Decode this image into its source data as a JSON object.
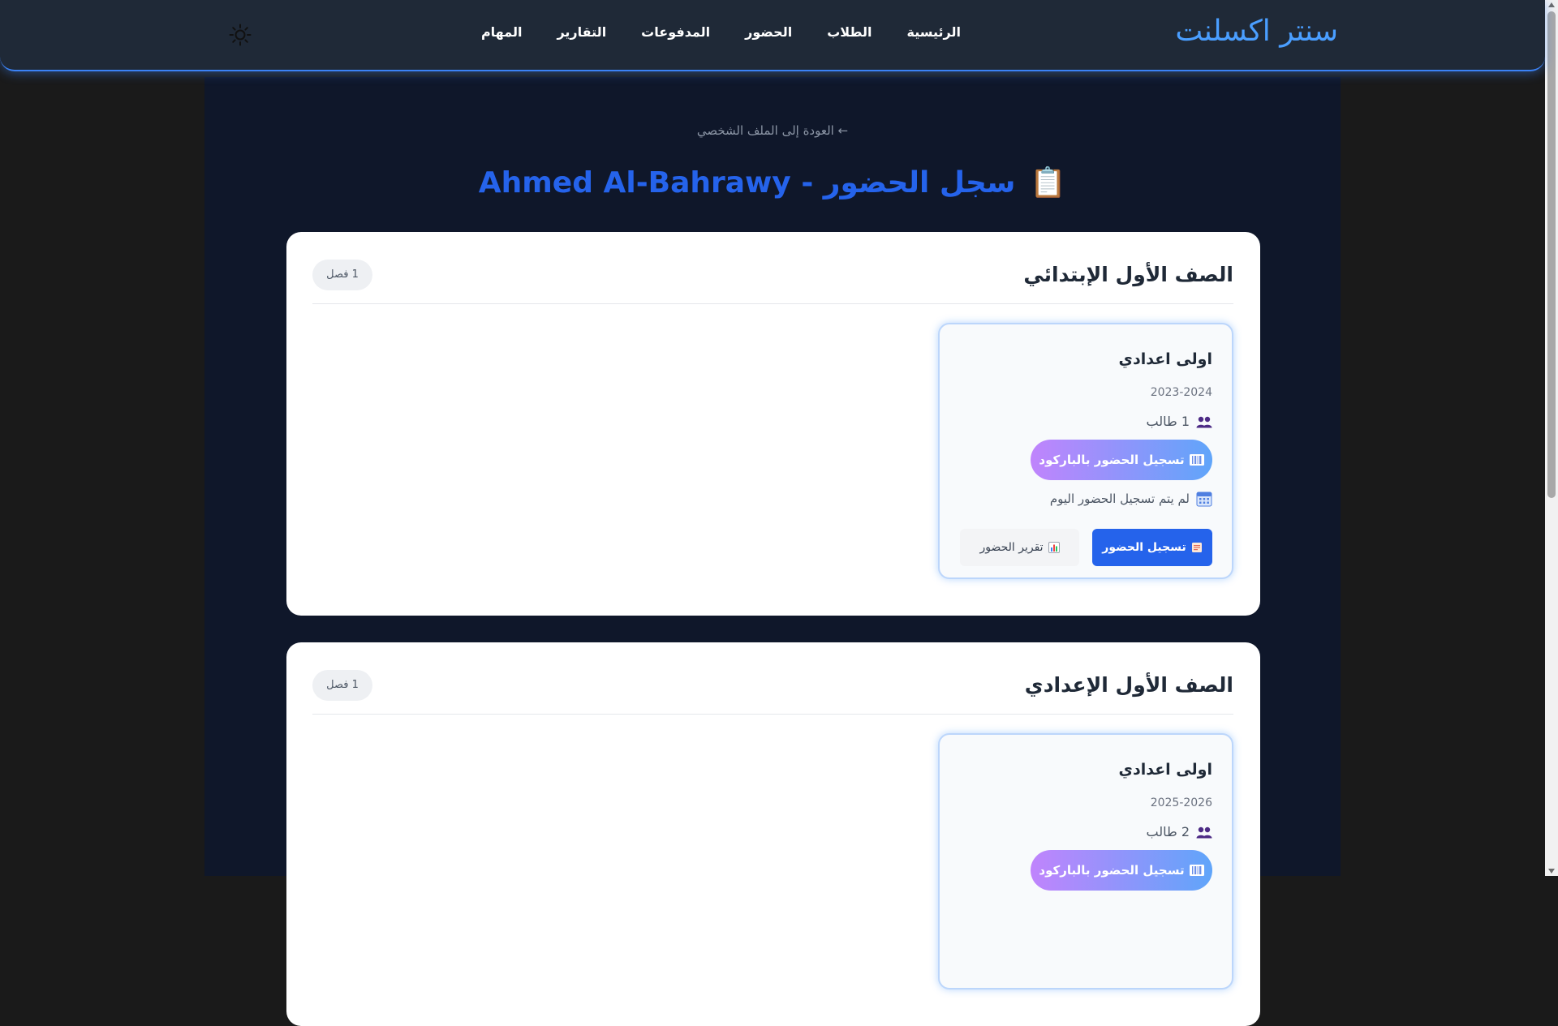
{
  "navbar": {
    "brand": "سنتر اكسلنت",
    "links": [
      "الرئيسية",
      "الطلاب",
      "الحضور",
      "المدفوعات",
      "التقارير",
      "المهام"
    ],
    "theme_icon": "sun-icon"
  },
  "page": {
    "back_link": "← العودة إلى الملف الشخصي",
    "title_icon": "📋",
    "title": "سجل الحضور - Ahmed Al-Bahrawy"
  },
  "grades": [
    {
      "title": "الصف الأول الإبتدائي",
      "badge": "1 فصل",
      "classes": [
        {
          "name": "اولى اعدادي",
          "year": "2023-2024",
          "students": "1 طالب",
          "barcode_button": "تسجيل الحضور بالباركود",
          "status": "لم يتم تسجيل الحضور اليوم",
          "record_button": "تسجيل الحضور",
          "report_button": "تقرير الحضور"
        }
      ]
    },
    {
      "title": "الصف الأول الإعدادي",
      "badge": "1 فصل",
      "classes": [
        {
          "name": "اولى اعدادي",
          "year": "2025-2026",
          "students": "2 طالب",
          "barcode_button": "تسجيل الحضور بالباركود"
        }
      ]
    }
  ],
  "colors": {
    "brand": "#4a9eff",
    "title": "#2563eb",
    "primary_button": "#2563eb",
    "barcode_gradient_start": "#c084fc",
    "barcode_gradient_end": "#60a5fa",
    "navbar_bg": "#1f2937",
    "panel_bg": "#0f172a"
  }
}
